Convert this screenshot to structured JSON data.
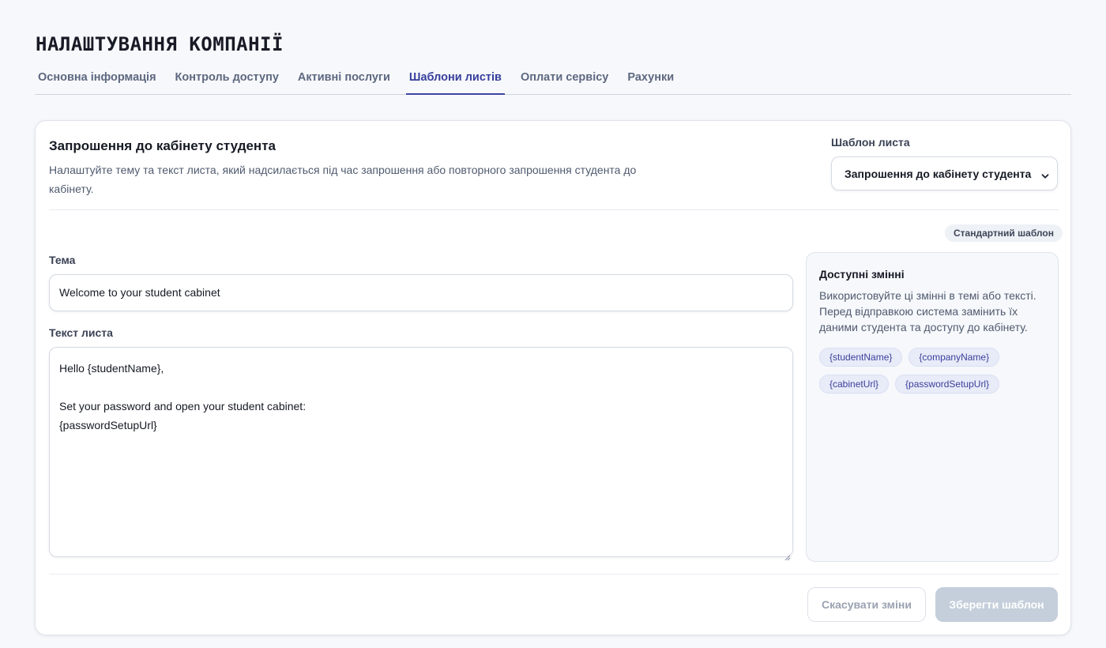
{
  "page": {
    "title": "НАЛАШТУВАННЯ КОМПАНІЇ"
  },
  "tabs": [
    {
      "label": "Основна інформація",
      "active": false
    },
    {
      "label": "Контроль доступу",
      "active": false
    },
    {
      "label": "Активні послуги",
      "active": false
    },
    {
      "label": "Шаблони листів",
      "active": true
    },
    {
      "label": "Оплати сервісу",
      "active": false
    },
    {
      "label": "Рахунки",
      "active": false
    }
  ],
  "card": {
    "title": "Запрошення до кабінету студента",
    "description": "Налаштуйте тему та текст листа, який надсилається під час запрошення або повторного запрошення студента до кабінету.",
    "template_select": {
      "label": "Шаблон листа",
      "value": "Запрошення до кабінету студента",
      "icon": "chevron-down-icon"
    },
    "badge": "Стандартний шаблон",
    "subject": {
      "label": "Тема",
      "value": "Welcome to your student cabinet"
    },
    "body": {
      "label": "Текст листа",
      "lines": [
        "Hello {studentName},",
        "",
        "Set your password and open your student cabinet:",
        "{passwordSetupUrl}"
      ]
    },
    "variables": {
      "title": "Доступні змінні",
      "description": "Використовуйте ці змінні в темі або тексті. Перед відправкою система замінить їх даними студента та доступу до кабінету.",
      "chips": [
        "{studentName}",
        "{companyName}",
        "{cabinetUrl}",
        "{passwordSetupUrl}"
      ]
    },
    "actions": {
      "cancel_label": "Скасувати зміни",
      "save_label": "Зберегти шаблон"
    }
  },
  "colors": {
    "accent": "#3c45a5",
    "save_button_disabled": "#c5cfdb",
    "chip_bg": "#e8ebf8",
    "chip_text": "#3a3f9a"
  }
}
